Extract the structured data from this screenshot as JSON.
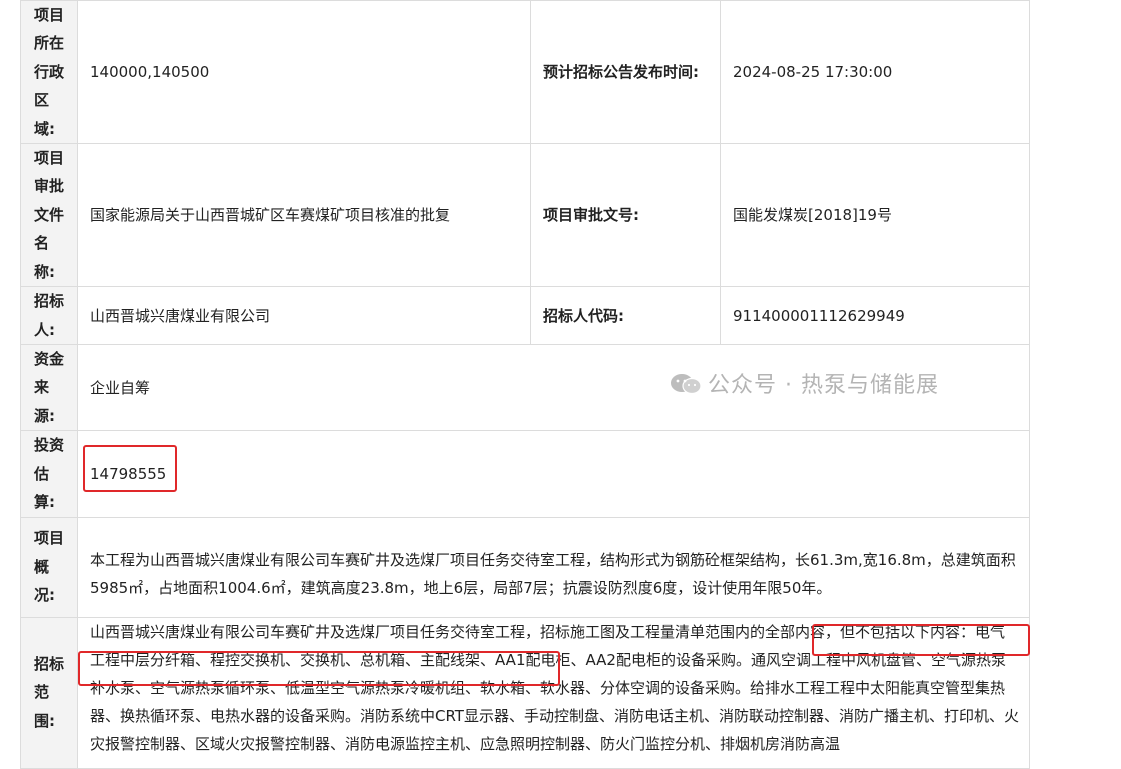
{
  "rows": {
    "region": {
      "label": "项目所在行政区域:",
      "value": "140000,140500",
      "label2": "预计招标公告发布时间:",
      "value2": "2024-08-25 17:30:00"
    },
    "approval": {
      "label": "项目审批文件名称:",
      "value": "国家能源局关于山西晋城矿区车赛煤矿项目核准的批复",
      "label2": "项目审批文号:",
      "value2": "国能发煤炭[2018]19号"
    },
    "tenderer": {
      "label": "招标人:",
      "value": "山西晋城兴唐煤业有限公司",
      "label2": "招标人代码:",
      "value2": "911400001112629949"
    },
    "funds": {
      "label": "资金来源:",
      "value": "企业自筹"
    },
    "investment": {
      "label": "投资估算:",
      "value": "14798555"
    },
    "overview": {
      "label": "项目概况:",
      "value": "本工程为山西晋城兴唐煤业有限公司车赛矿井及选煤厂项目任务交待室工程，结构形式为钢筋砼框架结构，长61.3m,宽16.8m，总建筑面积5985㎡，占地面积1004.6㎡，建筑高度23.8m，地上6层，局部7层；抗震设防烈度6度，设计使用年限50年。"
    },
    "scope": {
      "label": "招标范围:",
      "part1": "山西晋城兴唐煤业有限公司车赛矿井及选煤厂项目任务交待室工程，招标施工图及工程量清单范围内的全部内容，但不包括以下内容：电气工程中层分纤箱、程控交换机、交换机、总机箱、主配线架、AA1配电柜、AA2配电柜的设备采购。",
      "highlight": "通风空调工程中风机盘管、空气源热泵补水泵、空气源热泵循环泵、低温型空气源热泵冷暖机组、",
      "part2": "软水箱、软水器、分体空调的设备采购。给排水工程工程中太阳能真空管型集热器、换热循环泵、电热水器的设备采购。消防系统中CRT显示器、手动控制盘、消防电话主机、消防联动控制器、消防广播主机、打印机、火灾报警控制器、区域火灾报警控制器、消防电源监控主机、应急照明控制器、防火门监控分机、排烟机房消防高温"
    }
  },
  "watermark": {
    "text": "公众号 · 热泵与储能展",
    "icon": "wechat-icon"
  },
  "colors": {
    "highlight_border": "#e0282a",
    "label_bg": "#f3f3f3",
    "border": "#dcdcdc",
    "watermark": "#b4b4b4"
  }
}
